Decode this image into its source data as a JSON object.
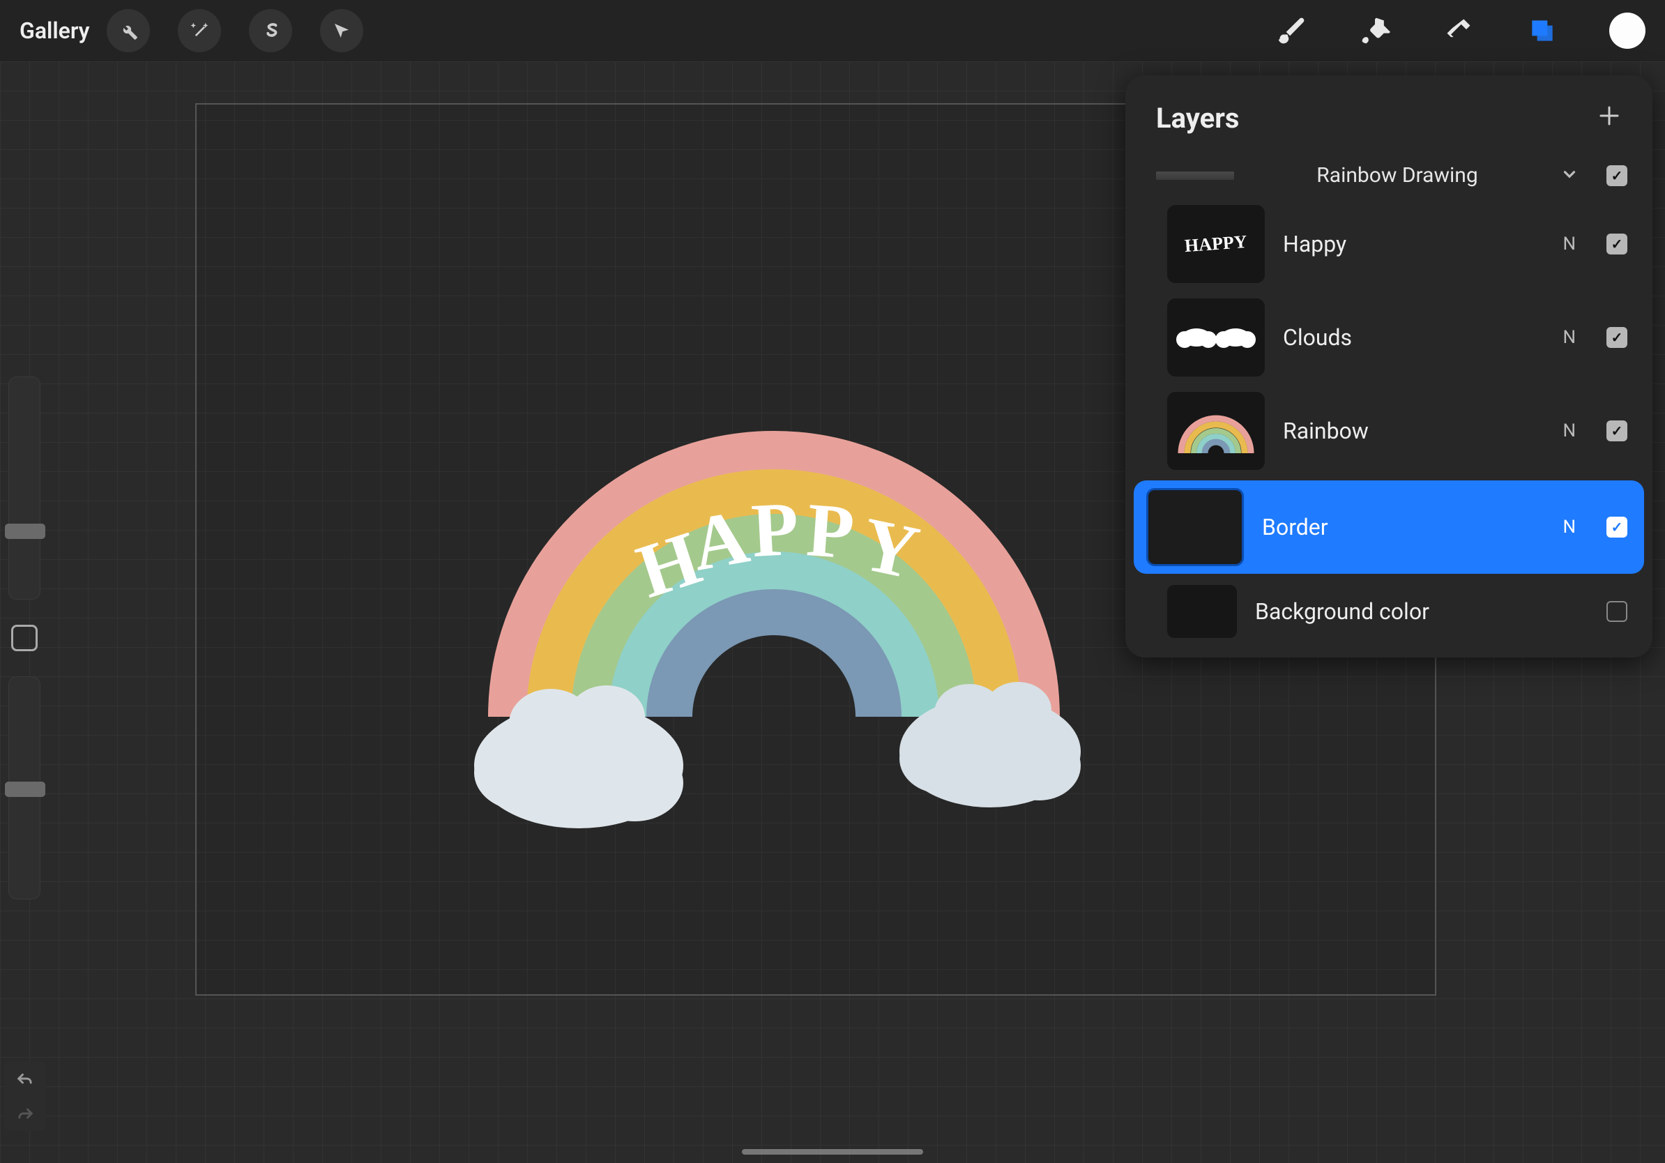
{
  "toolbar": {
    "gallery": "Gallery"
  },
  "layers_panel": {
    "title": "Layers",
    "group_name": "Rainbow Drawing",
    "layers": [
      {
        "name": "Happy",
        "blend": "N",
        "visible": true,
        "selected": false
      },
      {
        "name": "Clouds",
        "blend": "N",
        "visible": true,
        "selected": false
      },
      {
        "name": "Rainbow",
        "blend": "N",
        "visible": true,
        "selected": false
      },
      {
        "name": "Border",
        "blend": "N",
        "visible": true,
        "selected": true
      }
    ],
    "background": {
      "name": "Background color",
      "visible": false
    }
  },
  "artwork": {
    "text": "HAPPY",
    "colors": {
      "arc1": "#e8a19a",
      "arc2": "#e9bb4f",
      "arc3": "#a4c98d",
      "arc4": "#8fd0c8",
      "arc5": "#7b98b4",
      "cloud": "#dfe6eb"
    }
  },
  "current_color": "#fdfdfd"
}
